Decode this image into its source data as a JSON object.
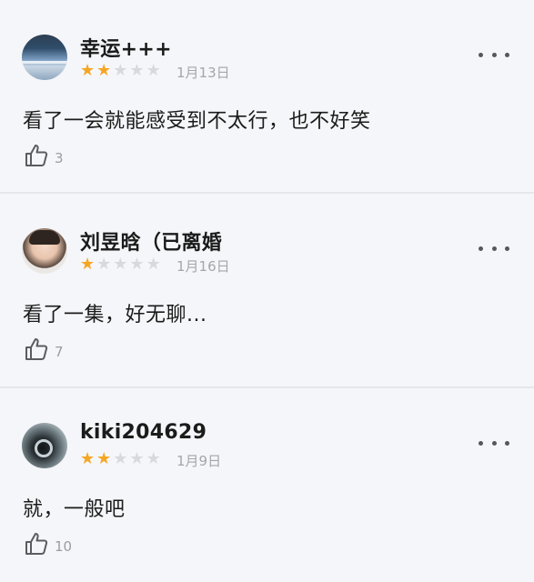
{
  "reviews": [
    {
      "username": "幸运+++",
      "rating": 2,
      "max_rating": 5,
      "date": "1月13日",
      "comment": "看了一会就能感受到不太行，也不好笑",
      "likes": "3"
    },
    {
      "username": "刘昱晗（已离婚",
      "rating": 1,
      "max_rating": 5,
      "date": "1月16日",
      "comment": "看了一集，好无聊...",
      "likes": "7"
    },
    {
      "username": "kiki204629",
      "rating": 2,
      "max_rating": 5,
      "date": "1月9日",
      "comment": "就，一般吧",
      "likes": "10"
    }
  ],
  "colors": {
    "star_on": "#f5a623",
    "star_off": "#d8d9dc",
    "background": "#f5f6f9",
    "divider": "#e6e7ea"
  },
  "icons": {
    "more": "more-dots-icon",
    "like": "thumbs-up-icon",
    "star": "star-icon"
  }
}
